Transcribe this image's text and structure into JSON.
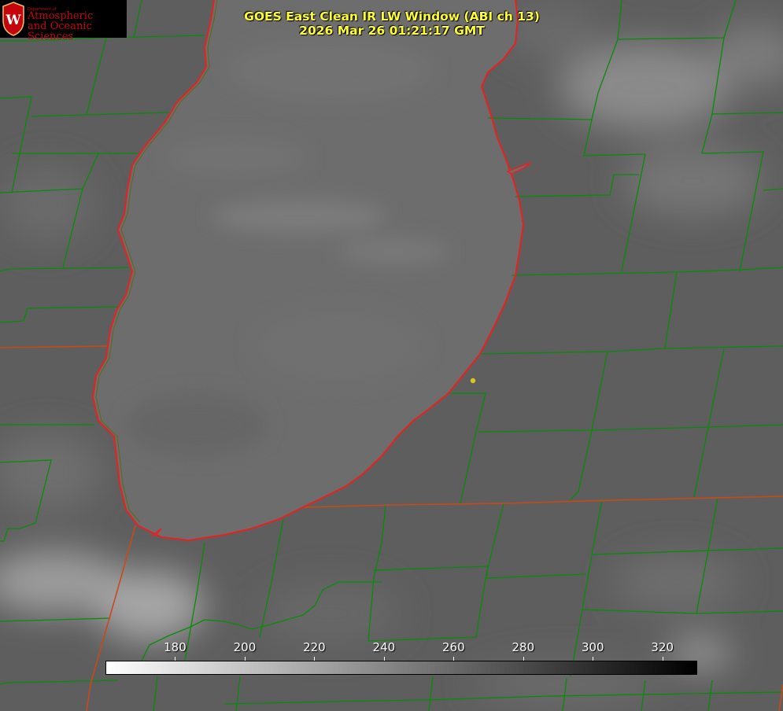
{
  "logo": {
    "department": "Department of",
    "line1": "Atmospheric",
    "line2": "and Oceanic Sciences",
    "color": "#c5050c"
  },
  "title": {
    "line1": "GOES East Clean IR LW Window (ABI ch 13)",
    "line2": "2026 Mar 26 01:21:17 GMT",
    "color": "#ffff33"
  },
  "colorbar": {
    "range": [
      160,
      330
    ],
    "ticks": [
      "180",
      "200",
      "220",
      "240",
      "260",
      "280",
      "300",
      "320"
    ],
    "gradient": [
      "#ffffff",
      "#000000"
    ]
  },
  "map": {
    "lake_color": "#6d6d6d",
    "land_color": "#5e5e5e",
    "county_line_color": "#0a8a0a",
    "shoreline_color": "#e82020",
    "state_line_color": "#c84a1a",
    "marker_color": "#d8c81e"
  }
}
